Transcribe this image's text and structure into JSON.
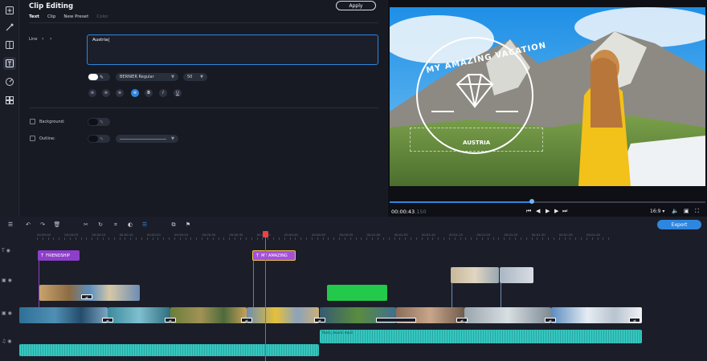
{
  "panel": {
    "title": "Clip Editing",
    "apply_label": "Apply",
    "tabs": [
      {
        "label": "Text",
        "active": true
      },
      {
        "label": "Clip",
        "active": false
      },
      {
        "label": "New Preset",
        "active": false
      },
      {
        "label": "Color",
        "disabled": true
      }
    ],
    "line_label": "Line",
    "line_prev": "‹",
    "line_next": "›",
    "text_value": "Austria",
    "font_name": "BERNIER Regular",
    "font_size": "50",
    "format_buttons": [
      "align-left",
      "align-center",
      "align-right",
      "align-justify",
      "bold",
      "italic",
      "underline"
    ],
    "bold_glyph": "B",
    "italic_glyph": "I",
    "underline_glyph": "U",
    "background_label": "Background:",
    "outline_label": "Outline:"
  },
  "preview": {
    "overlay_title": "MY AMAZING VACATION",
    "overlay_subtitle": "AUSTRIA",
    "time_main": "00:00:43",
    "time_frac": ".150",
    "progress": 0.45,
    "aspect": "16:9",
    "aspect_caret": "▾",
    "icons": [
      "skip-back-icon",
      "step-back-icon",
      "play-icon",
      "step-forward-icon",
      "skip-forward-icon",
      "volume-icon",
      "snapshot-icon",
      "fullscreen-icon"
    ]
  },
  "timeline": {
    "export_label": "Export",
    "ruler": [
      "00:00:00",
      "00:00:05",
      "00:00:10",
      "00:00:15",
      "00:00:20",
      "00:00:25",
      "00:00:30",
      "00:00:35",
      "00:00:40",
      "00:00:45",
      "00:00:50",
      "00:00:55",
      "00:01:00",
      "00:01:05",
      "00:01:10",
      "00:01:15",
      "00:01:20",
      "00:01:25",
      "00:01:30",
      "00:01:35",
      "00:01:40"
    ],
    "title_clips": [
      {
        "label": "FRIENDSHIP",
        "glyph": "T"
      },
      {
        "label": "MY AMAZING",
        "glyph": "T"
      }
    ],
    "audio_clip_label": "Rock_music.mp3"
  },
  "colors": {
    "accent": "#2f86de",
    "title_clip": "#8e3fc9",
    "title_clip_selected": "#a352d6",
    "selected_border": "#f2c14e",
    "audio": "#35c7c0",
    "green_clip": "#22c94a",
    "playhead": "#e8434b"
  }
}
